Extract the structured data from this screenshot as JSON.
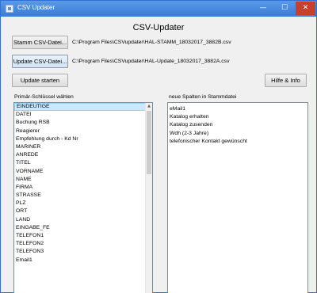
{
  "window": {
    "title": "CSV Updater",
    "minimize_glyph": "—",
    "maximize_glyph": "☐",
    "close_glyph": "✕"
  },
  "header": {
    "title": "CSV-Updater"
  },
  "files": {
    "stamm_button": "Stamm CSV-Datei...",
    "stamm_path": "C:\\Program Files\\CSVupdater\\HAL-STAMM_18032017_3882B.csv",
    "update_button": "Update CSV-Datei...",
    "update_path": "C:\\Program Files\\CSVupdater\\HAL-Update_18032017_3882A.csv"
  },
  "actions": {
    "start_button": "Update starten",
    "help_button": "Hilfe & Info"
  },
  "primary_keys": {
    "label": "Primär-Schlüssel wählen",
    "items": [
      "EINDEUTIGE",
      "DATEI",
      "Buchung RSB",
      "Reagierer",
      "Empfehlung durch - Kd Nr",
      "MARINER",
      "ANREDE",
      "TITEL",
      "VORNAME",
      "NAME",
      "FIRMA",
      "STRASSE",
      "PLZ",
      "ORT",
      "LAND",
      "EINGABE_FE",
      "TELEFON1",
      "TELEFON2",
      "TELEFON3",
      "Email1"
    ],
    "selected_index": 0,
    "scroll_up_glyph": "▲"
  },
  "new_columns": {
    "label": "neue Spalten in Stammdatei",
    "items": [
      "eMail1",
      "Katalog erhalten",
      "Katalog zusenden",
      "Wdh (2-3 Jahre)",
      "telefonischer Kontakt gewünscht"
    ]
  }
}
